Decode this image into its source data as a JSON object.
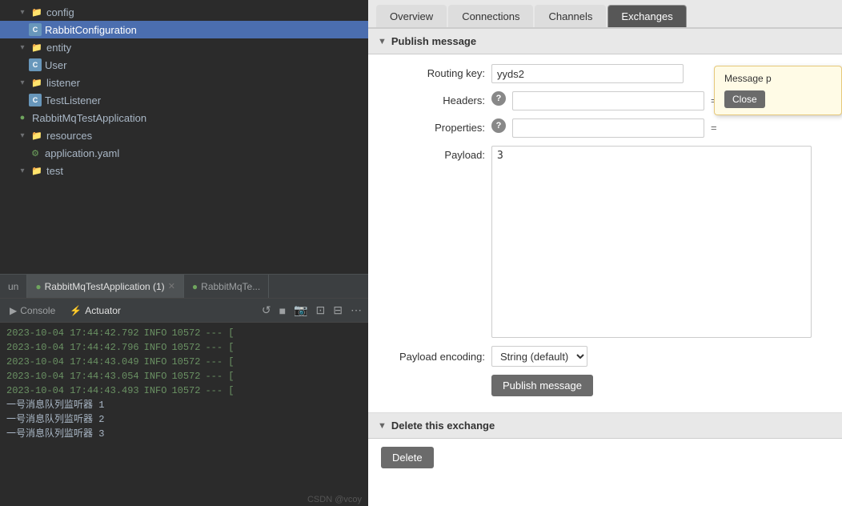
{
  "left": {
    "tree": {
      "items": [
        {
          "label": "config",
          "indent": 1,
          "type": "folder",
          "chevron": "▾"
        },
        {
          "label": "RabbitConfiguration",
          "indent": 2,
          "type": "java",
          "selected": true
        },
        {
          "label": "entity",
          "indent": 1,
          "type": "folder",
          "chevron": "▾"
        },
        {
          "label": "User",
          "indent": 2,
          "type": "java"
        },
        {
          "label": "listener",
          "indent": 1,
          "type": "folder",
          "chevron": "▾"
        },
        {
          "label": "TestListener",
          "indent": 2,
          "type": "java"
        },
        {
          "label": "RabbitMqTestApplication",
          "indent": 1,
          "type": "spring"
        },
        {
          "label": "resources",
          "indent": 1,
          "type": "folder",
          "chevron": "▾"
        },
        {
          "label": "application.yaml",
          "indent": 2,
          "type": "yaml"
        },
        {
          "label": "test",
          "indent": 1,
          "type": "folder",
          "chevron": "▾"
        }
      ]
    },
    "tabs": [
      {
        "label": "un",
        "icon": ""
      },
      {
        "label": "RabbitMqTestApplication (1)",
        "icon": "spring",
        "active": true,
        "closable": true
      },
      {
        "label": "RabbitMqTe...",
        "icon": "spring"
      }
    ],
    "bottom": {
      "tabs": [
        {
          "label": "Console",
          "icon": "▶",
          "active": false
        },
        {
          "label": "Actuator",
          "icon": "⚡",
          "active": true
        }
      ],
      "logs": [
        {
          "time": "2023-10-04 17:44:42.792",
          "level": "INFO",
          "pid": "10572",
          "rest": "--- ["
        },
        {
          "time": "2023-10-04 17:44:42.796",
          "level": "INFO",
          "pid": "10572",
          "rest": "--- ["
        },
        {
          "time": "2023-10-04 17:44:43.049",
          "level": "INFO",
          "pid": "10572",
          "rest": "--- ["
        },
        {
          "time": "2023-10-04 17:44:43.054",
          "level": "INFO",
          "pid": "10572",
          "rest": "--- ["
        },
        {
          "time": "2023-10-04 17:44:43.493",
          "level": "INFO",
          "pid": "10572",
          "rest": "--- ["
        }
      ],
      "chinese_lines": [
        "一号消息队列监听器 1",
        "一号消息队列监听器 2",
        "一号消息队列监听器 3"
      ]
    }
  },
  "right": {
    "tabs": [
      {
        "label": "Overview"
      },
      {
        "label": "Connections"
      },
      {
        "label": "Channels"
      },
      {
        "label": "Exchanges",
        "active": true
      }
    ],
    "publish_section": {
      "title": "Publish message",
      "routing_key_label": "Routing key:",
      "routing_key_value": "yyds2",
      "headers_label": "Headers:",
      "headers_value": "",
      "properties_label": "Properties:",
      "properties_value": "",
      "payload_label": "Payload:",
      "payload_value": "3",
      "payload_encoding_label": "Payload encoding:",
      "payload_encoding_value": "String (default)",
      "publish_btn_label": "Publish message",
      "tooltip": {
        "text": "Message p",
        "close_label": "Close"
      }
    },
    "delete_section": {
      "title": "Delete this exchange",
      "delete_btn_label": "Delete"
    }
  },
  "watermark": "CSDN @vcoy"
}
